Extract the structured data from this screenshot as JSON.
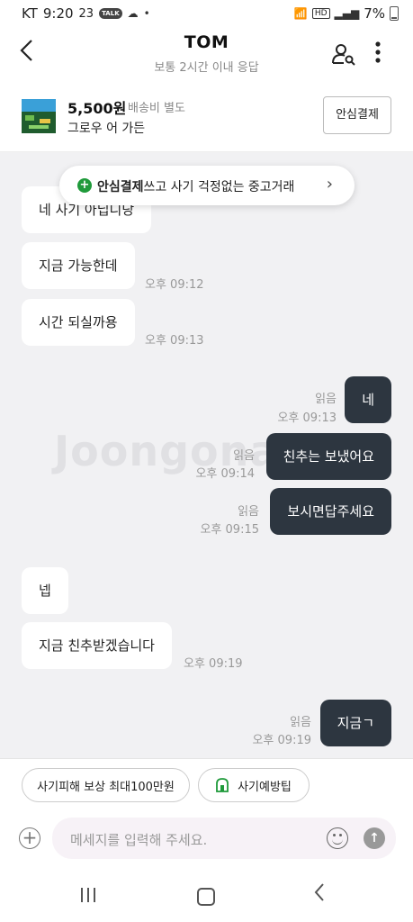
{
  "status_bar": {
    "carrier": "KT",
    "time": "9:20",
    "notif_badge": "23",
    "talk": "TALK",
    "hd": "HD",
    "battery": "7%"
  },
  "header": {
    "title": "TOM",
    "subtitle": "보통 2시간 이내 응답"
  },
  "product": {
    "price": "5,500원",
    "shipping": "배송비 별도",
    "name": "그로우 어 가든",
    "safe_pay_button": "안심결제"
  },
  "banner": {
    "bold": "안심결제",
    "text": "쓰고 사기 걱정없는 중고거래"
  },
  "watermark": "Joongonara",
  "messages": [
    {
      "dir": "in",
      "text": "네 사기 아닙니당",
      "time": "",
      "read": ""
    },
    {
      "dir": "in",
      "text": "지금 가능한데",
      "time": "오후 09:12",
      "read": ""
    },
    {
      "dir": "in",
      "text": "시간 되실까용",
      "time": "오후 09:13",
      "read": ""
    },
    {
      "dir": "out",
      "text": "네",
      "time": "오후 09:13",
      "read": "읽음"
    },
    {
      "dir": "out",
      "text": "친추는 보냈어요",
      "time": "오후 09:14",
      "read": "읽음"
    },
    {
      "dir": "out",
      "text": "보시면답주세요",
      "time": "오후 09:15",
      "read": "읽음"
    },
    {
      "dir": "in",
      "text": "넵",
      "time": "",
      "read": ""
    },
    {
      "dir": "in",
      "text": "지금 친추받겠습니다",
      "time": "오후 09:19",
      "read": ""
    },
    {
      "dir": "out",
      "text": "지금ㄱ",
      "time": "오후 09:19",
      "read": "읽음"
    }
  ],
  "quick_actions": {
    "compensation": "사기피해 보상 최대100만원",
    "tips": "사기예방팁"
  },
  "composer": {
    "placeholder": "메세지를 입력해 주세요."
  }
}
